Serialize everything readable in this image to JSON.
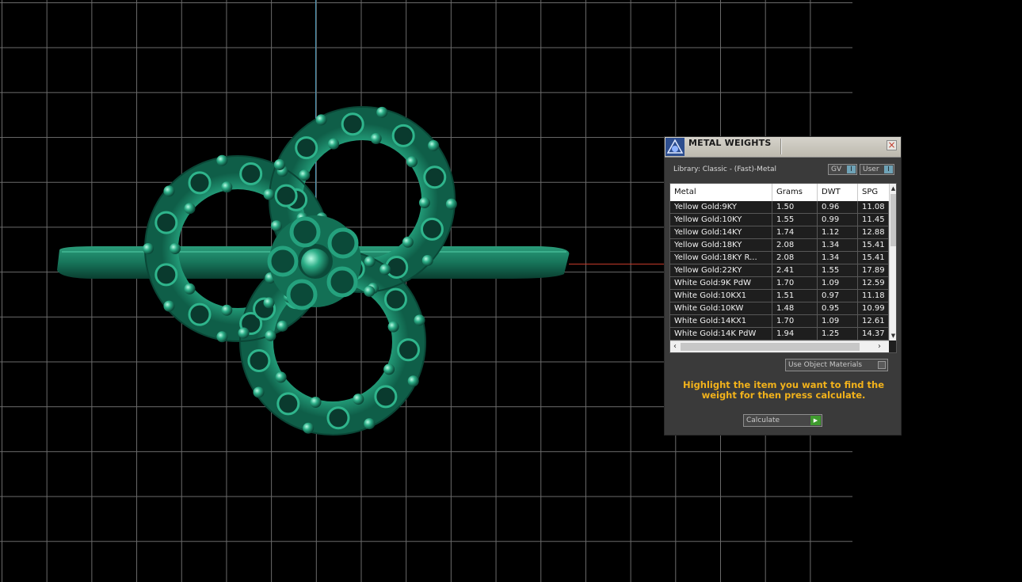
{
  "viewport": {
    "axis_v_color": "#4d98b8",
    "axis_h_color": "#c43a2a",
    "model_color": "#1f9a78"
  },
  "panel": {
    "title": "METAL WEIGHTS",
    "close_glyph": "×",
    "library": "Library: Classic - (Fast)-Metal",
    "gv_label": "GV",
    "user_label": "User",
    "toggle_glyph": "I",
    "columns": [
      "Metal",
      "Grams",
      "DWT",
      "SPG"
    ],
    "rows": [
      [
        "Yellow Gold:9KY",
        "1.50",
        "0.96",
        "11.08"
      ],
      [
        "Yellow Gold:10KY",
        "1.55",
        "0.99",
        "11.45"
      ],
      [
        "Yellow Gold:14KY",
        "1.74",
        "1.12",
        "12.88"
      ],
      [
        "Yellow Gold:18KY",
        "2.08",
        "1.34",
        "15.41"
      ],
      [
        "Yellow Gold:18KY R...",
        "2.08",
        "1.34",
        "15.41"
      ],
      [
        "Yellow Gold:22KY",
        "2.41",
        "1.55",
        "17.89"
      ],
      [
        "White Gold:9K PdW",
        "1.70",
        "1.09",
        "12.59"
      ],
      [
        "White Gold:10KX1",
        "1.51",
        "0.97",
        "11.18"
      ],
      [
        "White Gold:10KW",
        "1.48",
        "0.95",
        "10.99"
      ],
      [
        "White Gold:14KX1",
        "1.70",
        "1.09",
        "12.61"
      ],
      [
        "White Gold:14K PdW",
        "1.94",
        "1.25",
        "14.37"
      ]
    ],
    "use_object_materials": "Use Object Materials",
    "hint": "Highlight the item you want to find the weight for then press calculate.",
    "calculate": "Calculate",
    "accent": "#f2b21b",
    "calc_color": "#3f9b2e"
  }
}
